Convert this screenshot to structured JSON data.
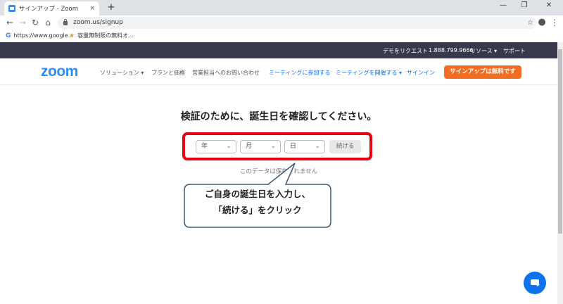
{
  "browser": {
    "tab_title": "サインアップ - Zoom",
    "tab_close": "×",
    "new_tab": "+",
    "window_controls": {
      "minimize": "—",
      "maximize": "❐",
      "close": "✕"
    },
    "url": "zoom.us/signup",
    "bookmarks": [
      "https://www.google...",
      "容量無制限の無料オ..."
    ]
  },
  "topbar": {
    "demo": "デモをリクエスト",
    "phone": "1.888.799.9666",
    "resources": "リソース ▾",
    "support": "サポート"
  },
  "nav": {
    "logo": "zoom",
    "solutions": "ソリューション ▾",
    "plans": "プランと価格",
    "contact_sales": "営業担当へのお問い合わせ",
    "join": "ミーティングに参加する",
    "host": "ミーティングを開催する ▾",
    "signin": "サインイン",
    "signup": "サインアップは無料です"
  },
  "form": {
    "heading": "検証のために、誕生日を確認してください。",
    "year": "年",
    "month": "月",
    "day": "日",
    "continue": "続ける",
    "note": "このデータは保存されません"
  },
  "callout": {
    "line1": "ご自身の誕生日を入力し、",
    "line2": "「続ける」をクリック"
  },
  "colors": {
    "brand": "#2d8cff",
    "accent": "#f26d21",
    "highlight": "#e60012",
    "topbar": "#39394d"
  }
}
